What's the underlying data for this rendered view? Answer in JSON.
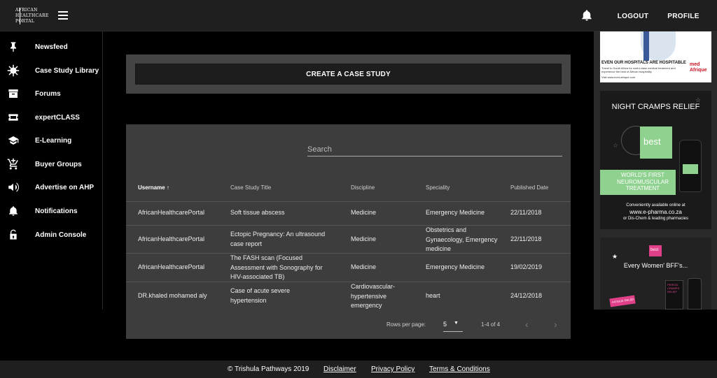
{
  "header": {
    "logo_lines": [
      "AFRICAN",
      "HEALTHCARE",
      "PORTAL"
    ],
    "logout_label": "LOGOUT",
    "profile_label": "PROFILE"
  },
  "sidebar": {
    "items": [
      {
        "label": "Newsfeed",
        "icon": "pin-icon"
      },
      {
        "label": "Case Study Library",
        "icon": "virus-icon"
      },
      {
        "label": "Forums",
        "icon": "archive-icon"
      },
      {
        "label": "expertCLASS",
        "icon": "ticket-icon"
      },
      {
        "label": "E-Learning",
        "icon": "graduation-cap-icon"
      },
      {
        "label": "Buyer Groups",
        "icon": "cart-plus-icon"
      },
      {
        "label": "Advertise on AHP",
        "icon": "megaphone-icon"
      },
      {
        "label": "Notifications",
        "icon": "bell-icon"
      },
      {
        "label": "Admin Console",
        "icon": "unlock-icon"
      }
    ]
  },
  "main": {
    "create_label": "CREATE A CASE STUDY",
    "search_placeholder": "Search",
    "columns": [
      "Username",
      "Case Study Title",
      "Discipline",
      "Speciality",
      "Published Date"
    ],
    "rows": [
      {
        "username": "AfricanHealthcarePortal",
        "title": "Soft tissue abscess",
        "discipline": "Medicine",
        "speciality": "Emergency Medicine",
        "date": "22/11/2018"
      },
      {
        "username": "AfricanHealthcarePortal",
        "title": "Ectopic Pregnancy: An ultrasound case report",
        "discipline": "Medicine",
        "speciality": "Obstetrics and Gynaecology, Emergency medicine",
        "date": "22/11/2018"
      },
      {
        "username": "AfricanHealthcarePortal",
        "title": "The FASH scan (Focused Assessment with Sonography for HIV-associated TB)",
        "discipline": "Medicine",
        "speciality": "Emergency Medicine",
        "date": "19/02/2019"
      },
      {
        "username": "DR.khaled mohamed aly",
        "title": "Case of acute severe hypertension",
        "discipline": "Cardiovascular-hypertensive emergency",
        "speciality": "heart",
        "date": "24/12/2018"
      }
    ],
    "pagination": {
      "rows_per_page_label": "Rows per page:",
      "rows_per_page_value": "5",
      "range": "1-4 of 4"
    }
  },
  "ads": {
    "ad1": {
      "headline": "EVEN OUR HOSPITALS ARE HOSPITABLE",
      "body": "Travel to South Africa for world-class medical treatment and experience the best of African hospitality.",
      "url": "Visit www.med-afrique.com",
      "brand": "med Afrique"
    },
    "ad2": {
      "headline": "NIGHT CRAMPS RELIEF",
      "brand": "best",
      "tagline": "WORLD'S FIRST NEUROMUSCULAR TREATMENT",
      "footer1": "Conveniently available online at",
      "footer2": "www.e-pharma.co.za",
      "footer3": "or Dis-Chem & leading pharmacies"
    },
    "ad3": {
      "brand": "best",
      "headline": "Every Women' BFF's...",
      "box1": "PERIOD CRAMPS RELIEF",
      "box2": "FATIGUE RELIEF"
    }
  },
  "footer": {
    "copyright": "© Trishula Pathways 2019",
    "disclaimer": "Disclaimer",
    "privacy": "Privacy Policy",
    "terms": "Terms & Conditions"
  },
  "colors": {
    "background": "#000000",
    "topbar": "#1f1f1f",
    "card": "#3d3d3d",
    "ad_green": "#8fd18f",
    "ad_pink": "#e0408a"
  }
}
